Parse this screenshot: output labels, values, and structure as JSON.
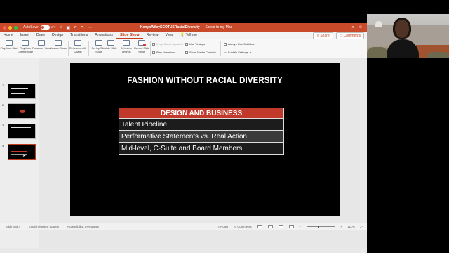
{
  "titlebar": {
    "autosave_label": "AutoSave",
    "toggle_label": "OFF",
    "doc_name": "KenyaWileySCOTUSRacialDiversity",
    "doc_status": "— Saved to my Mac"
  },
  "tabs": [
    "Home",
    "Insert",
    "Draw",
    "Design",
    "Transitions",
    "Animations",
    "Slide Show",
    "Review",
    "View",
    "Tell me"
  ],
  "active_tab": "Slide Show",
  "tabs_right": {
    "share": "Share",
    "comments": "Comments"
  },
  "ribbon": {
    "play_from_start": "Play from Start",
    "play_from_current": "Play from Current Slide",
    "presenter_view": "Presenter View",
    "custom_show": "Custom Show",
    "rehearse_coach": "Rehearse with Coach",
    "set_up_show": "Set Up Slide Show",
    "hide_slide": "Hide Slide",
    "rehearse_timings": "Rehearse Timings",
    "record_slide_show": "Record Slide Show",
    "keep_slides_updated": "Keep Slides Updated",
    "play_narrations": "Play Narrations",
    "use_timings": "Use Timings",
    "show_media_controls": "Show Media Controls",
    "always_use_subtitles": "Always Use Subtitles",
    "subtitle_settings": "Subtitle Settings"
  },
  "thumbnails": {
    "numbers": [
      "1",
      "2",
      "3",
      "4"
    ],
    "active": 4
  },
  "slide": {
    "title": "FASHION WITHOUT RACIAL DIVERSITY",
    "table_header": "DESIGN AND BUSINESS",
    "rows": [
      "Talent Pipeline",
      "Performative Statements vs. Real Action",
      "Mid-level, C-Suite and Board Members"
    ]
  },
  "statusbar": {
    "slide_count": "Slide 4 of 4",
    "language": "English (United States)",
    "accessibility": "Accessibility: Investigate",
    "notes": "Notes",
    "comments": "Comments",
    "zoom": "111%"
  },
  "colors": {
    "accent": "#c94a2b",
    "table_header": "#c0392b"
  }
}
